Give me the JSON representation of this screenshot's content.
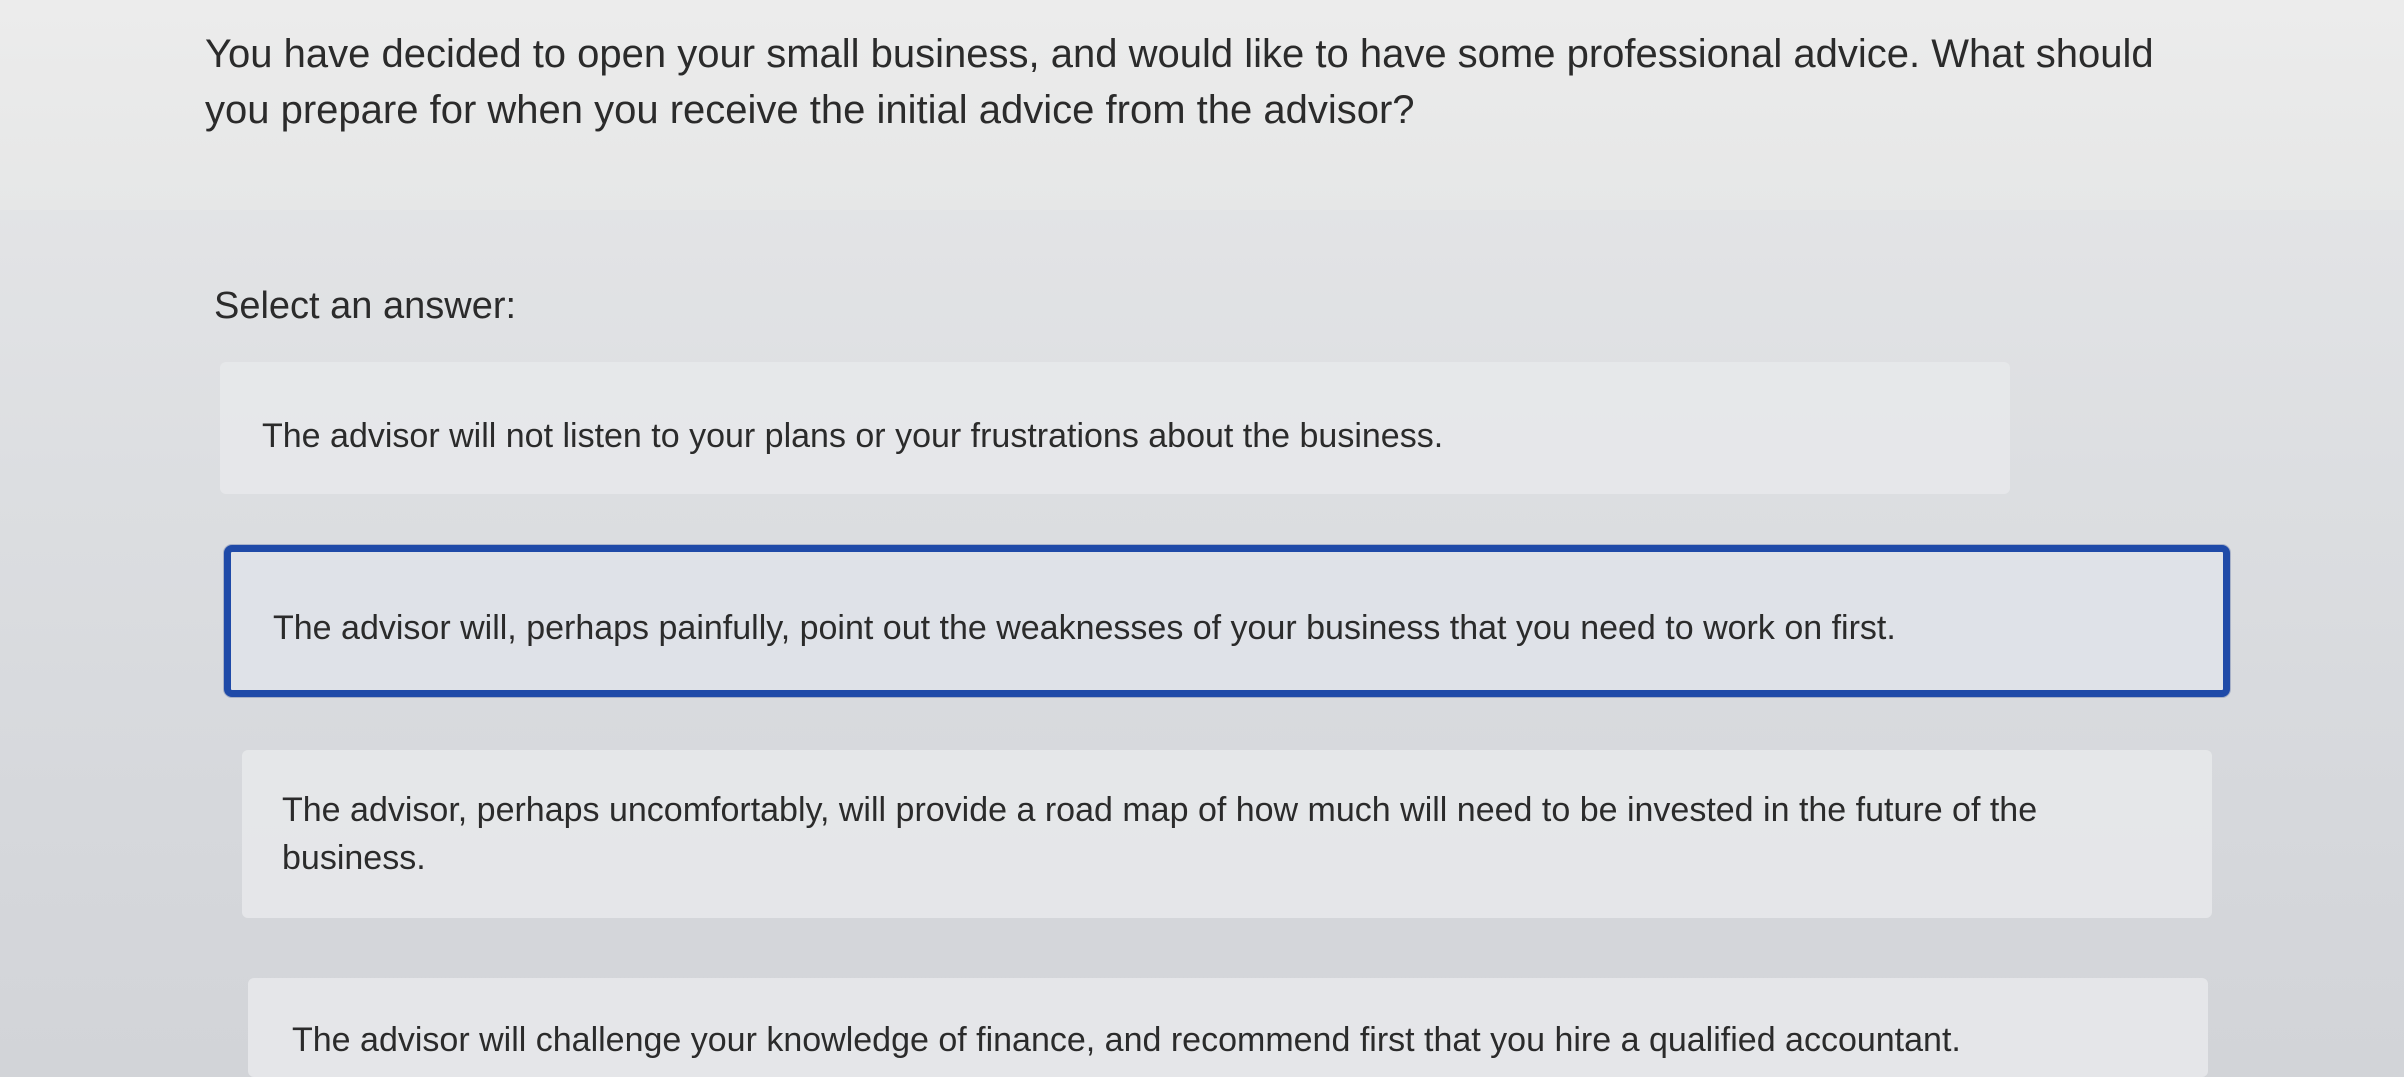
{
  "question": {
    "text": "You have decided to open your small business, and would like to have some professional advice. What should you prepare for when you receive the initial advice from the advisor?"
  },
  "prompt": {
    "label": "Select an answer:"
  },
  "options": [
    {
      "label": "The advisor will not listen to your plans or your frustrations about the business.",
      "selected": false
    },
    {
      "label": "The advisor will, perhaps painfully, point out the weaknesses of your business that you need to work on first.",
      "selected": true
    },
    {
      "label": "The advisor, perhaps uncomfortably, will provide a road map of how much will need to be invested in the future of the business.",
      "selected": false
    },
    {
      "label": "The advisor will challenge your knowledge of finance, and recommend first that you hire a qualified accountant.",
      "selected": false
    }
  ],
  "colors": {
    "selected_border": "#1f4aa8",
    "option_background": "#e7e8eb",
    "text": "#2b2b2b"
  }
}
